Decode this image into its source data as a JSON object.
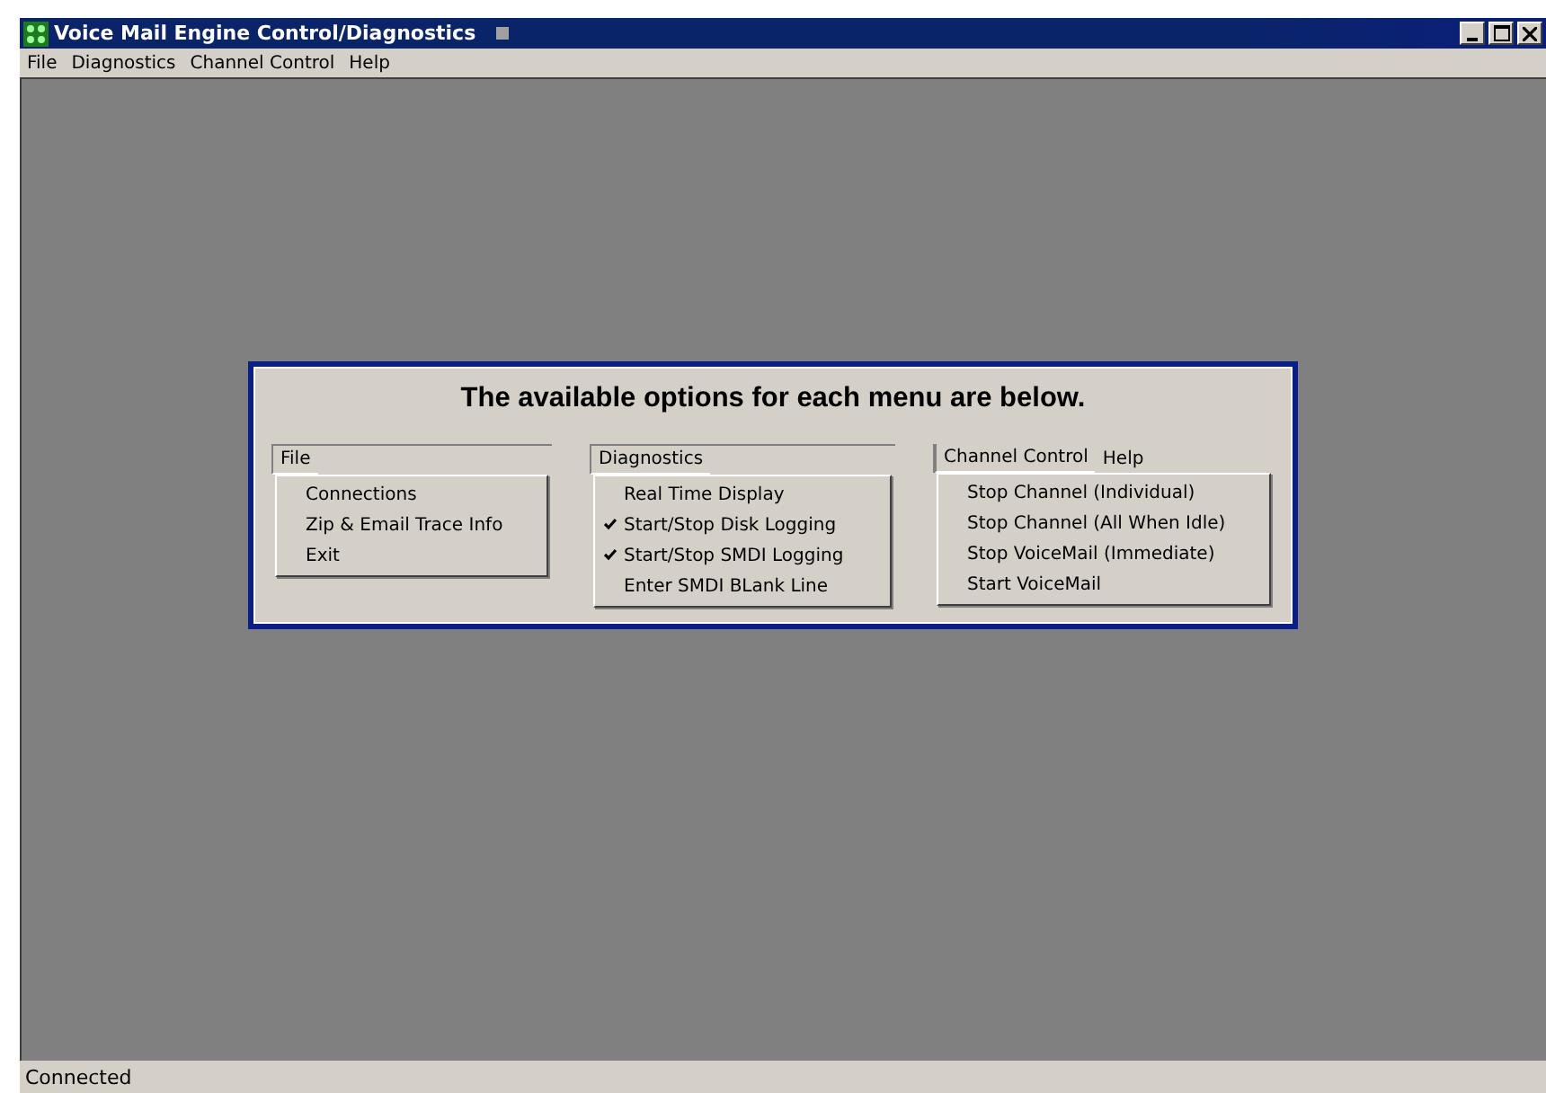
{
  "window": {
    "title": "Voice Mail Engine Control/Diagnostics"
  },
  "menu_bar": [
    "File",
    "Diagnostics",
    "Channel Control",
    "Help"
  ],
  "panel": {
    "heading": "The available options for each menu are below.",
    "menus": [
      {
        "headers": [
          {
            "label": "File",
            "selected": true
          }
        ],
        "items": [
          {
            "label": "Connections",
            "checked": false
          },
          {
            "label": "Zip & Email Trace Info",
            "checked": false
          },
          {
            "label": "Exit",
            "checked": false
          }
        ]
      },
      {
        "headers": [
          {
            "label": "Diagnostics",
            "selected": true
          }
        ],
        "items": [
          {
            "label": "Real Time Display",
            "checked": false
          },
          {
            "label": "Start/Stop Disk Logging",
            "checked": true
          },
          {
            "label": "Start/Stop SMDI Logging",
            "checked": true
          },
          {
            "label": "Enter SMDI BLank Line",
            "checked": false
          }
        ]
      },
      {
        "headers": [
          {
            "label": "Channel Control",
            "selected": true
          },
          {
            "label": "Help",
            "selected": false
          }
        ],
        "items": [
          {
            "label": "Stop Channel (Individual)",
            "checked": false
          },
          {
            "label": "Stop Channel (All When Idle)",
            "checked": false
          },
          {
            "label": "Stop VoiceMail (Immediate)",
            "checked": false
          },
          {
            "label": "Start VoiceMail",
            "checked": false
          }
        ]
      }
    ]
  },
  "status_bar": "Connected"
}
